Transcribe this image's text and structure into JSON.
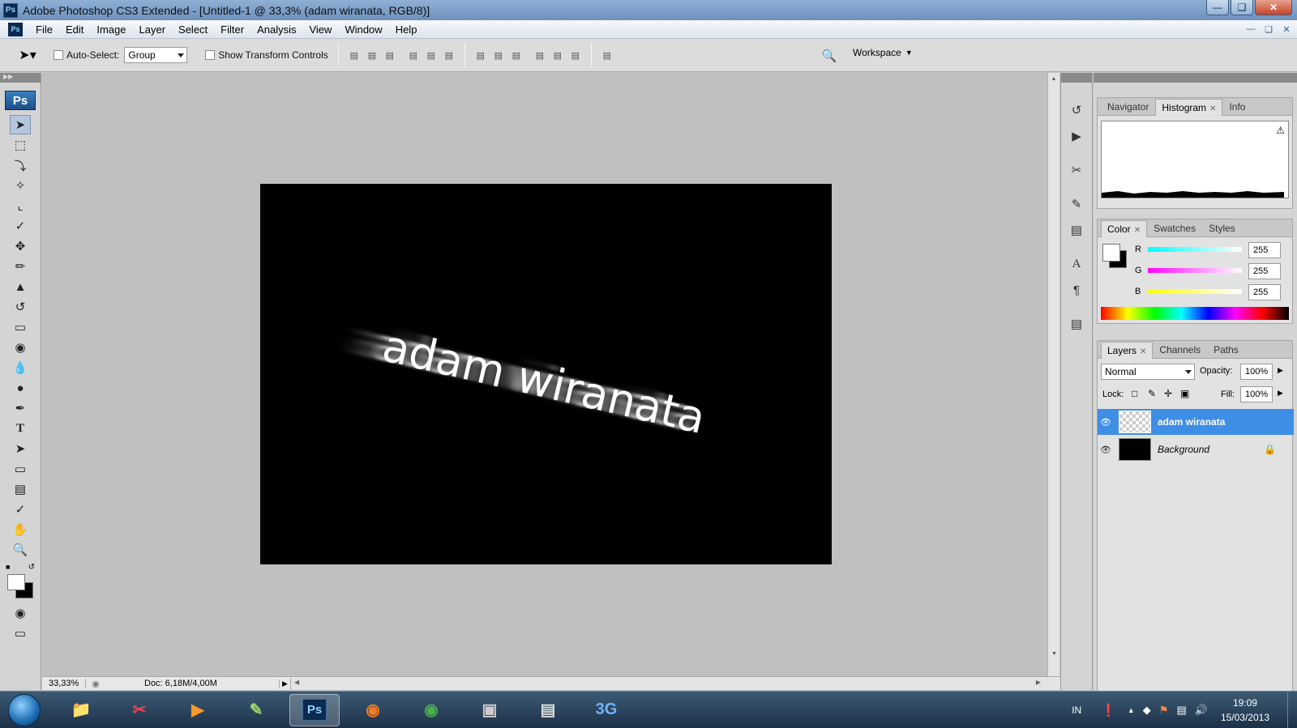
{
  "window": {
    "title": "Adobe Photoshop CS3 Extended - [Untitled-1 @ 33,3% (adam wiranata, RGB/8)]",
    "app_icon": "Ps"
  },
  "menu": [
    "File",
    "Edit",
    "Image",
    "Layer",
    "Select",
    "Filter",
    "Analysis",
    "View",
    "Window",
    "Help"
  ],
  "options": {
    "auto_select_label": "Auto-Select:",
    "auto_select_value": "Group",
    "show_transform_label": "Show Transform Controls",
    "workspace_label": "Workspace"
  },
  "toolbox": {
    "logo": "Ps",
    "tools": [
      "move-tool",
      "marquee-tool",
      "lasso-tool",
      "magic-wand-tool",
      "crop-tool",
      "slice-tool",
      "healing-brush-tool",
      "brush-tool",
      "clone-stamp-tool",
      "history-brush-tool",
      "eraser-tool",
      "paint-bucket-tool",
      "blur-tool",
      "dodge-tool",
      "pen-tool",
      "type-tool",
      "path-selection-tool",
      "rectangle-tool",
      "notes-tool",
      "eyedropper-tool",
      "hand-tool",
      "zoom-tool"
    ]
  },
  "canvas": {
    "text": "adam wiranata",
    "background": "#000000",
    "text_color": "#ffffff"
  },
  "status": {
    "zoom": "33,33%",
    "doc": "Doc: 6,18M/4,00M"
  },
  "navigator_panel": {
    "tabs": [
      "Navigator",
      "Histogram",
      "Info"
    ],
    "active": "Histogram"
  },
  "color_panel": {
    "tabs": [
      "Color",
      "Swatches",
      "Styles"
    ],
    "active": "Color",
    "channels": [
      {
        "label": "R",
        "value": "255"
      },
      {
        "label": "G",
        "value": "255"
      },
      {
        "label": "B",
        "value": "255"
      }
    ]
  },
  "layers_panel": {
    "tabs": [
      "Layers",
      "Channels",
      "Paths"
    ],
    "active": "Layers",
    "blend_mode": "Normal",
    "opacity_label": "Opacity:",
    "opacity": "100%",
    "lock_label": "Lock:",
    "fill_label": "Fill:",
    "fill": "100%",
    "layers": [
      {
        "name": "adam wiranata",
        "selected": true
      },
      {
        "name": "Background",
        "selected": false
      }
    ]
  },
  "taskbar": {
    "apps": [
      "Ps",
      "3G"
    ],
    "language": "IN",
    "time": "19:09",
    "date": "15/03/2013"
  },
  "colors": {
    "accent": "#3f8ee6",
    "selected_layer": "#3f8ee6"
  }
}
